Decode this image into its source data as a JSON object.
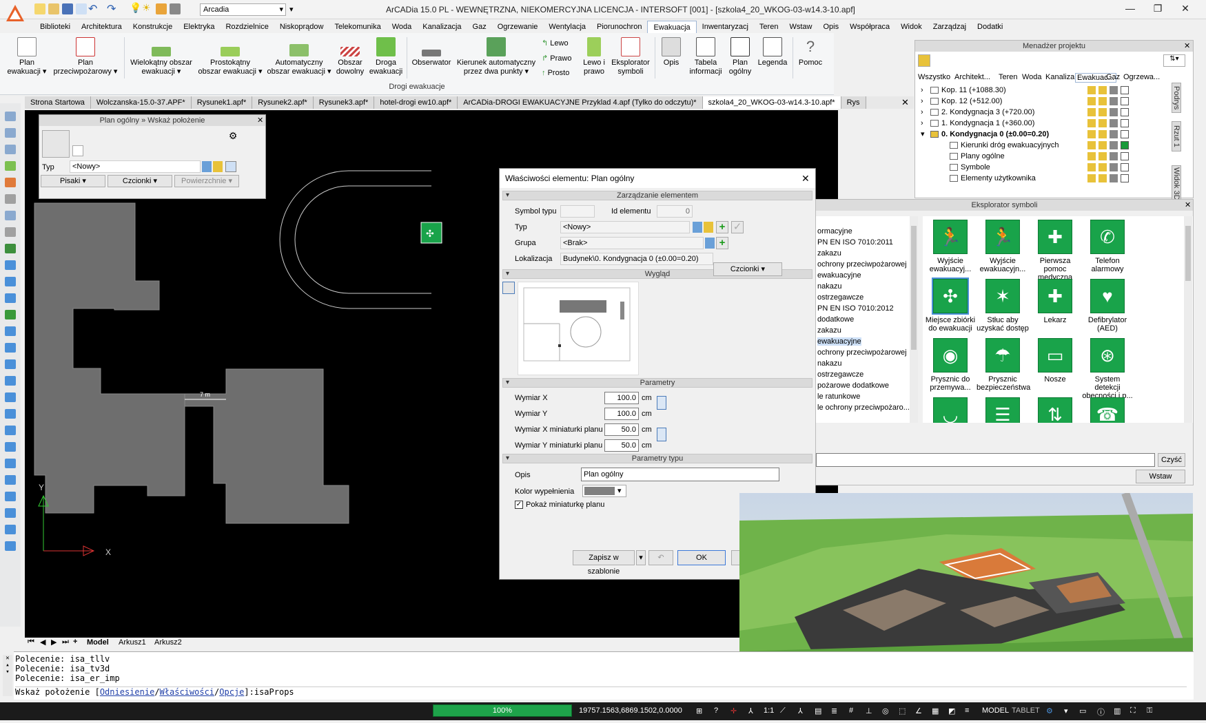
{
  "window": {
    "title": "ArCADia 15.0 PL - WEWNĘTRZNA, NIEKOMERCYJNA LICENCJA - INTERSOFT [001] - [szkola4_20_WKOG-03-w14.3-10.apf]",
    "layer": "Arcadia",
    "minimize": "—",
    "restore": "❐",
    "close": "✕",
    "logo_color": "#e8622a"
  },
  "menu_tabs": [
    "Biblioteki",
    "Architektura",
    "Konstrukcje",
    "Elektryka",
    "Rozdzielnice",
    "Niskoprądow",
    "Telekomunika",
    "Woda",
    "Kanalizacja",
    "Gaz",
    "Ogrzewanie",
    "Wentylacja",
    "Piorunochron",
    "Ewakuacja",
    "Inwentaryzacj",
    "Teren",
    "Wstaw",
    "Opis",
    "Współpraca",
    "Widok",
    "Zarządzaj",
    "Dodatki"
  ],
  "active_menu_tab": "Ewakuacja",
  "ribbon": {
    "group_label": "Drogi ewakuacje",
    "buttons": [
      {
        "label": "Plan\newakuacji ▾"
      },
      {
        "label": "Plan\nprzeciwpożarowy ▾"
      },
      {
        "label": "Wielokątny obszar\newakuacji ▾"
      },
      {
        "label": "Prostokątny\nobszar ewakuacji ▾"
      },
      {
        "label": "Automatyczny\nobszar ewakuacji ▾"
      },
      {
        "label": "Obszar\ndowolny"
      },
      {
        "label": "Droga\newakuacji"
      },
      {
        "label": "Obserwator"
      },
      {
        "label": "Kierunek automatyczny\nprzez dwa punkty ▾"
      },
      {
        "label": "Lewo i\nprawo"
      },
      {
        "label": "Eksplorator\nsymboli"
      },
      {
        "label": "Opis"
      },
      {
        "label": "Tabela\ninformacji"
      },
      {
        "label": "Plan\nogólny"
      },
      {
        "label": "Legenda"
      },
      {
        "label": "Pomoc"
      }
    ],
    "small": {
      "lewo": "Lewo",
      "prawo": "Prawo",
      "prosto": "Prosto"
    }
  },
  "doc_tabs": [
    "Strona Startowa",
    "Wolczanska-15.0-37.APF*",
    "Rysunek1.apf*",
    "Rysunek2.apf*",
    "Rysunek3.apf*",
    "hotel-drogi ew10.apf*",
    "ArCADia-DROGI EWAKUACYJNE Przyklad 4.apf (Tylko do odczytu)*",
    "szkola4_20_WKOG-03-w14.3-10.apf*",
    "Rys"
  ],
  "active_doc_tab": "szkola4_20_WKOG-03-w14.3-10.apf*",
  "floating_panel": {
    "title": "Plan ogólny » Wskaż położenie",
    "typ_label": "Typ",
    "typ_value": "<Nowy>",
    "pisaki": "Pisaki",
    "czcionki": "Czcionki",
    "powierzchnie": "Powierzchnie"
  },
  "canvas": {
    "dimension_text": "7 m",
    "axis_y": "Y",
    "axis_x": "X"
  },
  "sheet_tabs": [
    "Model",
    "Arkusz1",
    "Arkusz2"
  ],
  "dialog": {
    "title": "Właściwości elementu: Plan ogólny",
    "sections": {
      "management": "Zarządzanie elementem",
      "appearance": "Wygląd",
      "params": "Parametry",
      "type_params": "Parametry typu"
    },
    "symbol_typu_label": "Symbol typu",
    "id_label": "Id elementu",
    "id_value": "0",
    "typ_label": "Typ",
    "typ_value": "<Nowy>",
    "grupa_label": "Grupa",
    "grupa_value": "<Brak>",
    "lokalizacja_label": "Lokalizacja",
    "lokalizacja_value": "Budynek\\0. Kondygnacja 0 (±0.00=0.20)",
    "czcionki": "Czcionki",
    "params": [
      {
        "label": "Wymiar X",
        "value": "100.0",
        "unit": "cm"
      },
      {
        "label": "Wymiar Y",
        "value": "100.0",
        "unit": "cm"
      },
      {
        "label": "Wymiar X miniaturki planu",
        "value": "50.0",
        "unit": "cm"
      },
      {
        "label": "Wymiar Y miniaturki planu",
        "value": "50.0",
        "unit": "cm"
      }
    ],
    "opis_label": "Opis",
    "opis_value": "Plan ogólny",
    "kolor_label": "Kolor wypełnienia",
    "kolor_value": "#808080",
    "checkbox_label": "Pokaż miniaturkę planu",
    "checkbox_checked": true,
    "save_template": "Zapisz w szablonie",
    "ok": "OK",
    "cancel": "Anuluj"
  },
  "project_manager": {
    "title": "Menadżer projektu",
    "tabs": [
      "Wszystko",
      "Architekt...",
      "Teren",
      "Woda",
      "Kanaliza...",
      "Ewakuac...",
      "Gaz",
      "Ogrzewa..."
    ],
    "tree": [
      {
        "label": "Kop. 11 (+1088.30)",
        "bold": false
      },
      {
        "label": "Kop. 12 (+512.00)",
        "bold": false
      },
      {
        "label": "2. Kondygnacja 3 (+720.00)",
        "bold": false
      },
      {
        "label": "1. Kondygnacja 1 (+360.00)",
        "bold": false
      },
      {
        "label": "0. Kondygnacja 0 (±0.00=0.20)",
        "bold": true
      },
      {
        "label": "Kierunki dróg ewakuacyjnych",
        "bold": false
      },
      {
        "label": "Plany ogólne",
        "bold": false
      },
      {
        "label": "Symbole",
        "bold": false
      },
      {
        "label": "Elementy użytkownika",
        "bold": false
      }
    ],
    "side_tabs": [
      "Podrys",
      "Rzut 1",
      "Widok 3D"
    ]
  },
  "symbol_explorer": {
    "title": "Eksplorator symboli",
    "list": [
      "ormacyjne",
      "PN EN ISO 7010:2011",
      "zakazu",
      "ochrony przeciwpożarowej",
      "ewakuacyjne",
      "nakazu",
      "ostrzegawcze",
      "PN EN ISO 7010:2012",
      "dodatkowe",
      "zakazu",
      "ewakuacyjne",
      "ochrony przeciwpożarowej",
      "nakazu",
      "ostrzegawcze",
      "pożarowe dodatkowe",
      "le ratunkowe",
      "le ochrony przeciwpożaro..."
    ],
    "selected_list_item": 10,
    "symbols": [
      {
        "label": "Wyjście ewakuacyj...",
        "icon": "exit-run"
      },
      {
        "label": "Wyjście ewakuacyjn...",
        "icon": "exit-run"
      },
      {
        "label": "Pierwsza pomoc medyczna",
        "icon": "cross"
      },
      {
        "label": "Telefon alarmowy",
        "icon": "phone"
      },
      {
        "label": "Miejsce zbiórki do ewakuacji",
        "icon": "assembly"
      },
      {
        "label": "Stłuc aby uzyskać dostęp",
        "icon": "break"
      },
      {
        "label": "Lekarz",
        "icon": "doctor"
      },
      {
        "label": "Defibrylator (AED)",
        "icon": "heart"
      },
      {
        "label": "Prysznic do przemywa...",
        "icon": "eye"
      },
      {
        "label": "Prysznic bezpieczeństwa",
        "icon": "shower"
      },
      {
        "label": "Nosze",
        "icon": "stretcher"
      },
      {
        "label": "System detekcji obecności i p...",
        "icon": "detect"
      },
      {
        "label": "",
        "icon": "basin"
      },
      {
        "label": "",
        "icon": "ladder"
      },
      {
        "label": "",
        "icon": "lift"
      },
      {
        "label": "",
        "icon": "phone2"
      }
    ],
    "clear_button": "Czyść",
    "insert_button": "Wstaw"
  },
  "command": {
    "lines": [
      "Polecenie: isa_tllv",
      "Polecenie: isa_tv3d",
      "Polecenie: isa_er_imp"
    ],
    "prompt_prefix": "Wskaż położenie [",
    "opt1": "Odniesienie",
    "opt2": "Właściwości",
    "opt3": "Opcje",
    "prompt_suffix": "]:isaProps"
  },
  "status": {
    "progress": "100%",
    "coords": "19757.1563,6869.1502,0.0000",
    "scale": "1:1",
    "model": "MODEL",
    "tablet": "TABLET"
  }
}
